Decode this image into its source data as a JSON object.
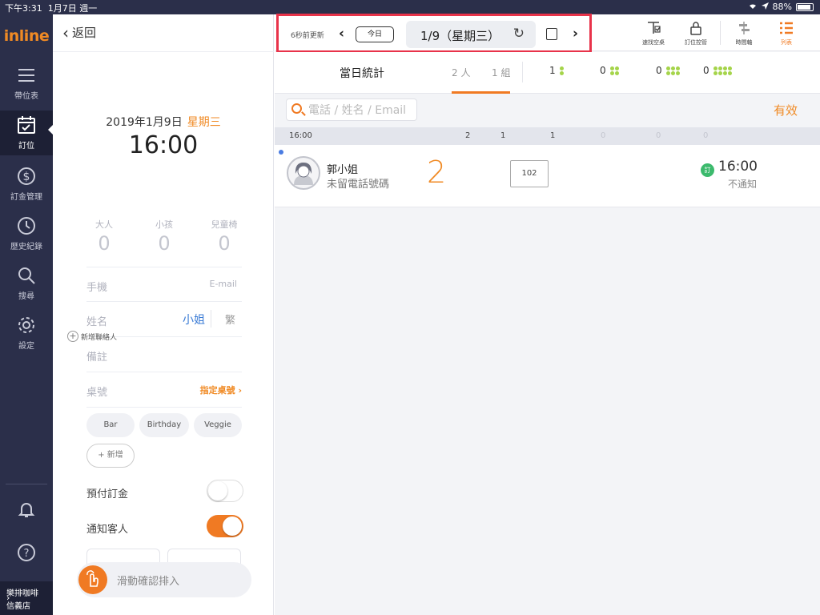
{
  "status": {
    "time": "下午3:31",
    "date": "1月7日 週一",
    "battery": "88%",
    "battery_level": 0.88
  },
  "sidebar": {
    "logo": "inline",
    "items": [
      {
        "label": "帶位表",
        "icon": "menu-icon"
      },
      {
        "label": "訂位",
        "icon": "calendar-check-icon",
        "active": true
      },
      {
        "label": "訂金管理",
        "icon": "dollar-icon"
      },
      {
        "label": "歷史紀錄",
        "icon": "clock-icon"
      },
      {
        "label": "搜尋",
        "icon": "search-icon"
      },
      {
        "label": "設定",
        "icon": "gear-icon"
      }
    ],
    "store_line1": "樂排咖啡",
    "store_line2": "信義店"
  },
  "form": {
    "back_label": "返回",
    "date": "2019年1月9日",
    "weekday": "星期三",
    "time": "16:00",
    "counts": [
      {
        "label": "大人",
        "value": "0"
      },
      {
        "label": "小孩",
        "value": "0"
      },
      {
        "label": "兒童椅",
        "value": "0"
      }
    ],
    "phone_label": "手機",
    "email_label": "E-mail",
    "name_label": "姓名",
    "title_miss": "小姐",
    "title_mr": "繁",
    "add_contact": "新增聯絡人",
    "note_label": "備註",
    "table_label": "桌號",
    "assign_table": "指定桌號",
    "tags": [
      "Bar",
      "Birthday",
      "Veggie"
    ],
    "add_tag": "新增",
    "deposit_label": "預付訂金",
    "deposit_on": false,
    "notify_label": "通知客人",
    "notify_on": true,
    "swipe_label": "滑動確認排入"
  },
  "toolbar": {
    "updated": "6秒前更新",
    "today": "今日",
    "date": "1/9（星期三）",
    "tools": [
      {
        "label": "速找空桌",
        "icon": "table-search-icon"
      },
      {
        "label": "訂位控管",
        "icon": "lock-icon"
      },
      {
        "label": "時間軸",
        "icon": "timeline-icon"
      },
      {
        "label": "列表",
        "icon": "list-icon",
        "active": true
      }
    ]
  },
  "stats": {
    "title": "當日統計",
    "people": "2 人",
    "groups": "1 組",
    "group_sizes": [
      {
        "count": "1",
        "dots": 2
      },
      {
        "count": "0",
        "dots": 4
      },
      {
        "count": "0",
        "dots": 6
      },
      {
        "count": "0",
        "dots": 8
      }
    ]
  },
  "list": {
    "search_placeholder": "電話 / 姓名 / Email",
    "filter": "有效",
    "slot": {
      "time": "16:00",
      "people": "2",
      "groups": "1",
      "g1": "1",
      "g2": "0",
      "g3": "0",
      "g4": "0"
    },
    "reservations": [
      {
        "name": "郭小姐",
        "phone": "未留電話號碼",
        "party": "2",
        "table": "102",
        "badge": "訂",
        "time": "16:00",
        "notify": "不通知"
      }
    ]
  },
  "colors": {
    "accent": "#f07a23",
    "sidebar": "#2b2f4a",
    "highlight": "#e8334a",
    "dots": "#a5d44a"
  }
}
